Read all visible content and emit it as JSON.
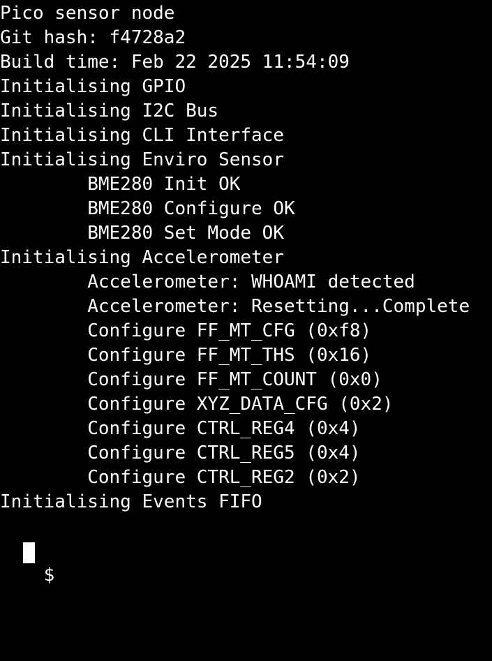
{
  "terminal": {
    "background_color": "#000000",
    "foreground_color": "#ffffff",
    "title": "Pico sensor node",
    "lines": [
      "Pico sensor node",
      "Git hash: f4728a2",
      "Build time: Feb 22 2025 11:54:09",
      "Initialising GPIO",
      "Initialising I2C Bus",
      "Initialising CLI Interface",
      "Initialising Enviro Sensor",
      "        BME280 Init OK",
      "        BME280 Configure OK",
      "        BME280 Set Mode OK",
      "Initialising Accelerometer",
      "        Accelerometer: WHOAMI detected",
      "        Accelerometer: Resetting...Complete",
      "        Configure FF_MT_CFG (0xf8)",
      "        Configure FF_MT_THS (0x16)",
      "        Configure FF_MT_COUNT (0x0)",
      "        Configure XYZ_DATA_CFG (0x2)",
      "        Configure CTRL_REG4 (0x4)",
      "        Configure CTRL_REG5 (0x4)",
      "        Configure CTRL_REG2 (0x2)",
      "Initialising Events FIFO",
      ""
    ],
    "boot_banner": {
      "device_name": "Pico sensor node",
      "git_hash_label": "Git hash:",
      "git_hash": "f4728a2",
      "build_time_label": "Build time:",
      "build_time": "Feb 22 2025 11:54:09"
    },
    "init_steps": [
      "Initialising GPIO",
      "Initialising I2C Bus",
      "Initialising CLI Interface",
      "Initialising Enviro Sensor",
      "Initialising Accelerometer",
      "Initialising Events FIFO"
    ],
    "enviro_sensor": {
      "chip": "BME280",
      "results": [
        "BME280 Init OK",
        "BME280 Configure OK",
        "BME280 Set Mode OK"
      ]
    },
    "accelerometer": {
      "status": [
        "Accelerometer: WHOAMI detected",
        "Accelerometer: Resetting...Complete"
      ],
      "registers": [
        {
          "name": "FF_MT_CFG",
          "value": "0xf8"
        },
        {
          "name": "FF_MT_THS",
          "value": "0x16"
        },
        {
          "name": "FF_MT_COUNT",
          "value": "0x0"
        },
        {
          "name": "XYZ_DATA_CFG",
          "value": "0x2"
        },
        {
          "name": "CTRL_REG4",
          "value": "0x4"
        },
        {
          "name": "CTRL_REG5",
          "value": "0x4"
        },
        {
          "name": "CTRL_REG2",
          "value": "0x2"
        }
      ]
    },
    "prompt": {
      "symbol": "$",
      "input_value": "",
      "cursor": "block-cursor"
    }
  }
}
